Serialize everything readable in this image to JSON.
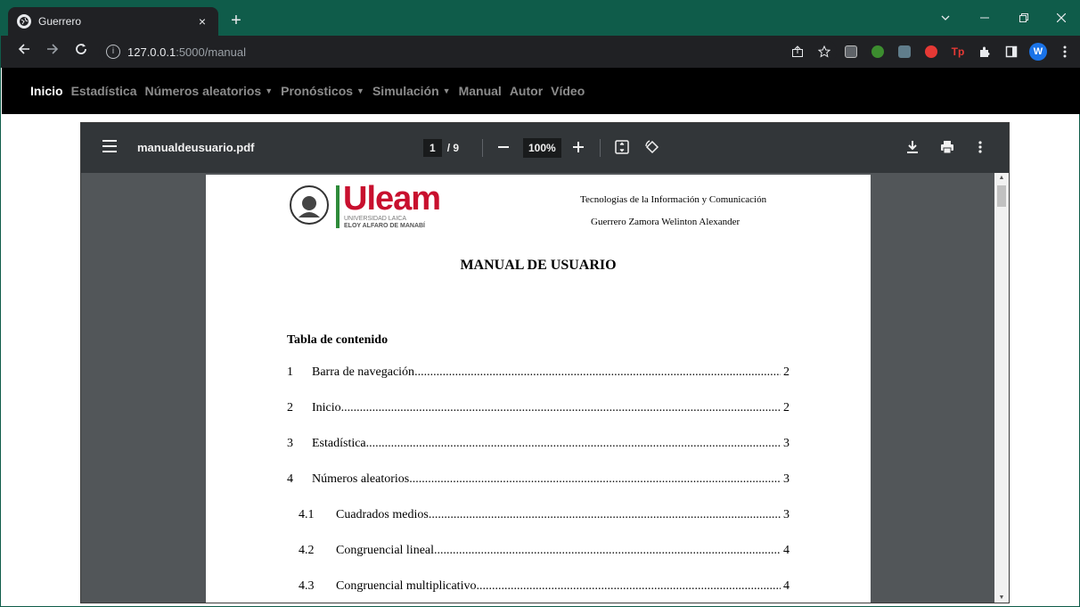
{
  "browser": {
    "tab_title": "Guerrero",
    "url_host": "127.0.0.1",
    "url_path": ":5000/manual",
    "close_glyph": "×",
    "newtab_glyph": "+"
  },
  "navbar": {
    "items": [
      {
        "label": "Inicio",
        "dropdown": false,
        "active": true
      },
      {
        "label": "Estadística",
        "dropdown": false,
        "active": false
      },
      {
        "label": "Números aleatorios",
        "dropdown": true,
        "active": false
      },
      {
        "label": "Pronósticos",
        "dropdown": true,
        "active": false
      },
      {
        "label": "Simulación",
        "dropdown": true,
        "active": false
      },
      {
        "label": "Manual",
        "dropdown": false,
        "active": false
      },
      {
        "label": "Autor",
        "dropdown": false,
        "active": false
      },
      {
        "label": "Vídeo",
        "dropdown": false,
        "active": false
      }
    ]
  },
  "pdf": {
    "filename": "manualdeusuario.pdf",
    "current_page": "1",
    "total_pages": "/ 9",
    "zoom": "100%",
    "logo_text": "Uleam",
    "logo_sub1": "UNIVERSIDAD LAICA",
    "logo_sub2": "ELOY ALFARO DE MANABÍ",
    "header_line1": "Tecnologías de la Información y Comunicación",
    "header_line2": "Guerrero Zamora Welinton Alexander",
    "title": "MANUAL DE USUARIO",
    "toc_title": "Tabla de contenido",
    "toc": [
      {
        "num": "1",
        "label": "Barra de navegación",
        "page": "2",
        "sub": false
      },
      {
        "num": "2",
        "label": "Inicio",
        "page": "2",
        "sub": false
      },
      {
        "num": "3",
        "label": "Estadística",
        "page": "3",
        "sub": false
      },
      {
        "num": "4",
        "label": "Números aleatorios",
        "page": "3",
        "sub": false
      },
      {
        "num": "4.1",
        "label": "Cuadrados medios",
        "page": "3",
        "sub": true
      },
      {
        "num": "4.2",
        "label": "Congruencial lineal",
        "page": "4",
        "sub": true
      },
      {
        "num": "4.3",
        "label": "Congruencial multiplicativo",
        "page": "4",
        "sub": true
      }
    ]
  },
  "colors": {
    "tabstrip": "#0f5c4a",
    "toolbar": "#202124",
    "navbar": "#000000",
    "pdf_toolbar": "#323639",
    "pdf_background": "#525659",
    "logo_red": "#c8102e",
    "logo_green": "#2e8b3a"
  }
}
